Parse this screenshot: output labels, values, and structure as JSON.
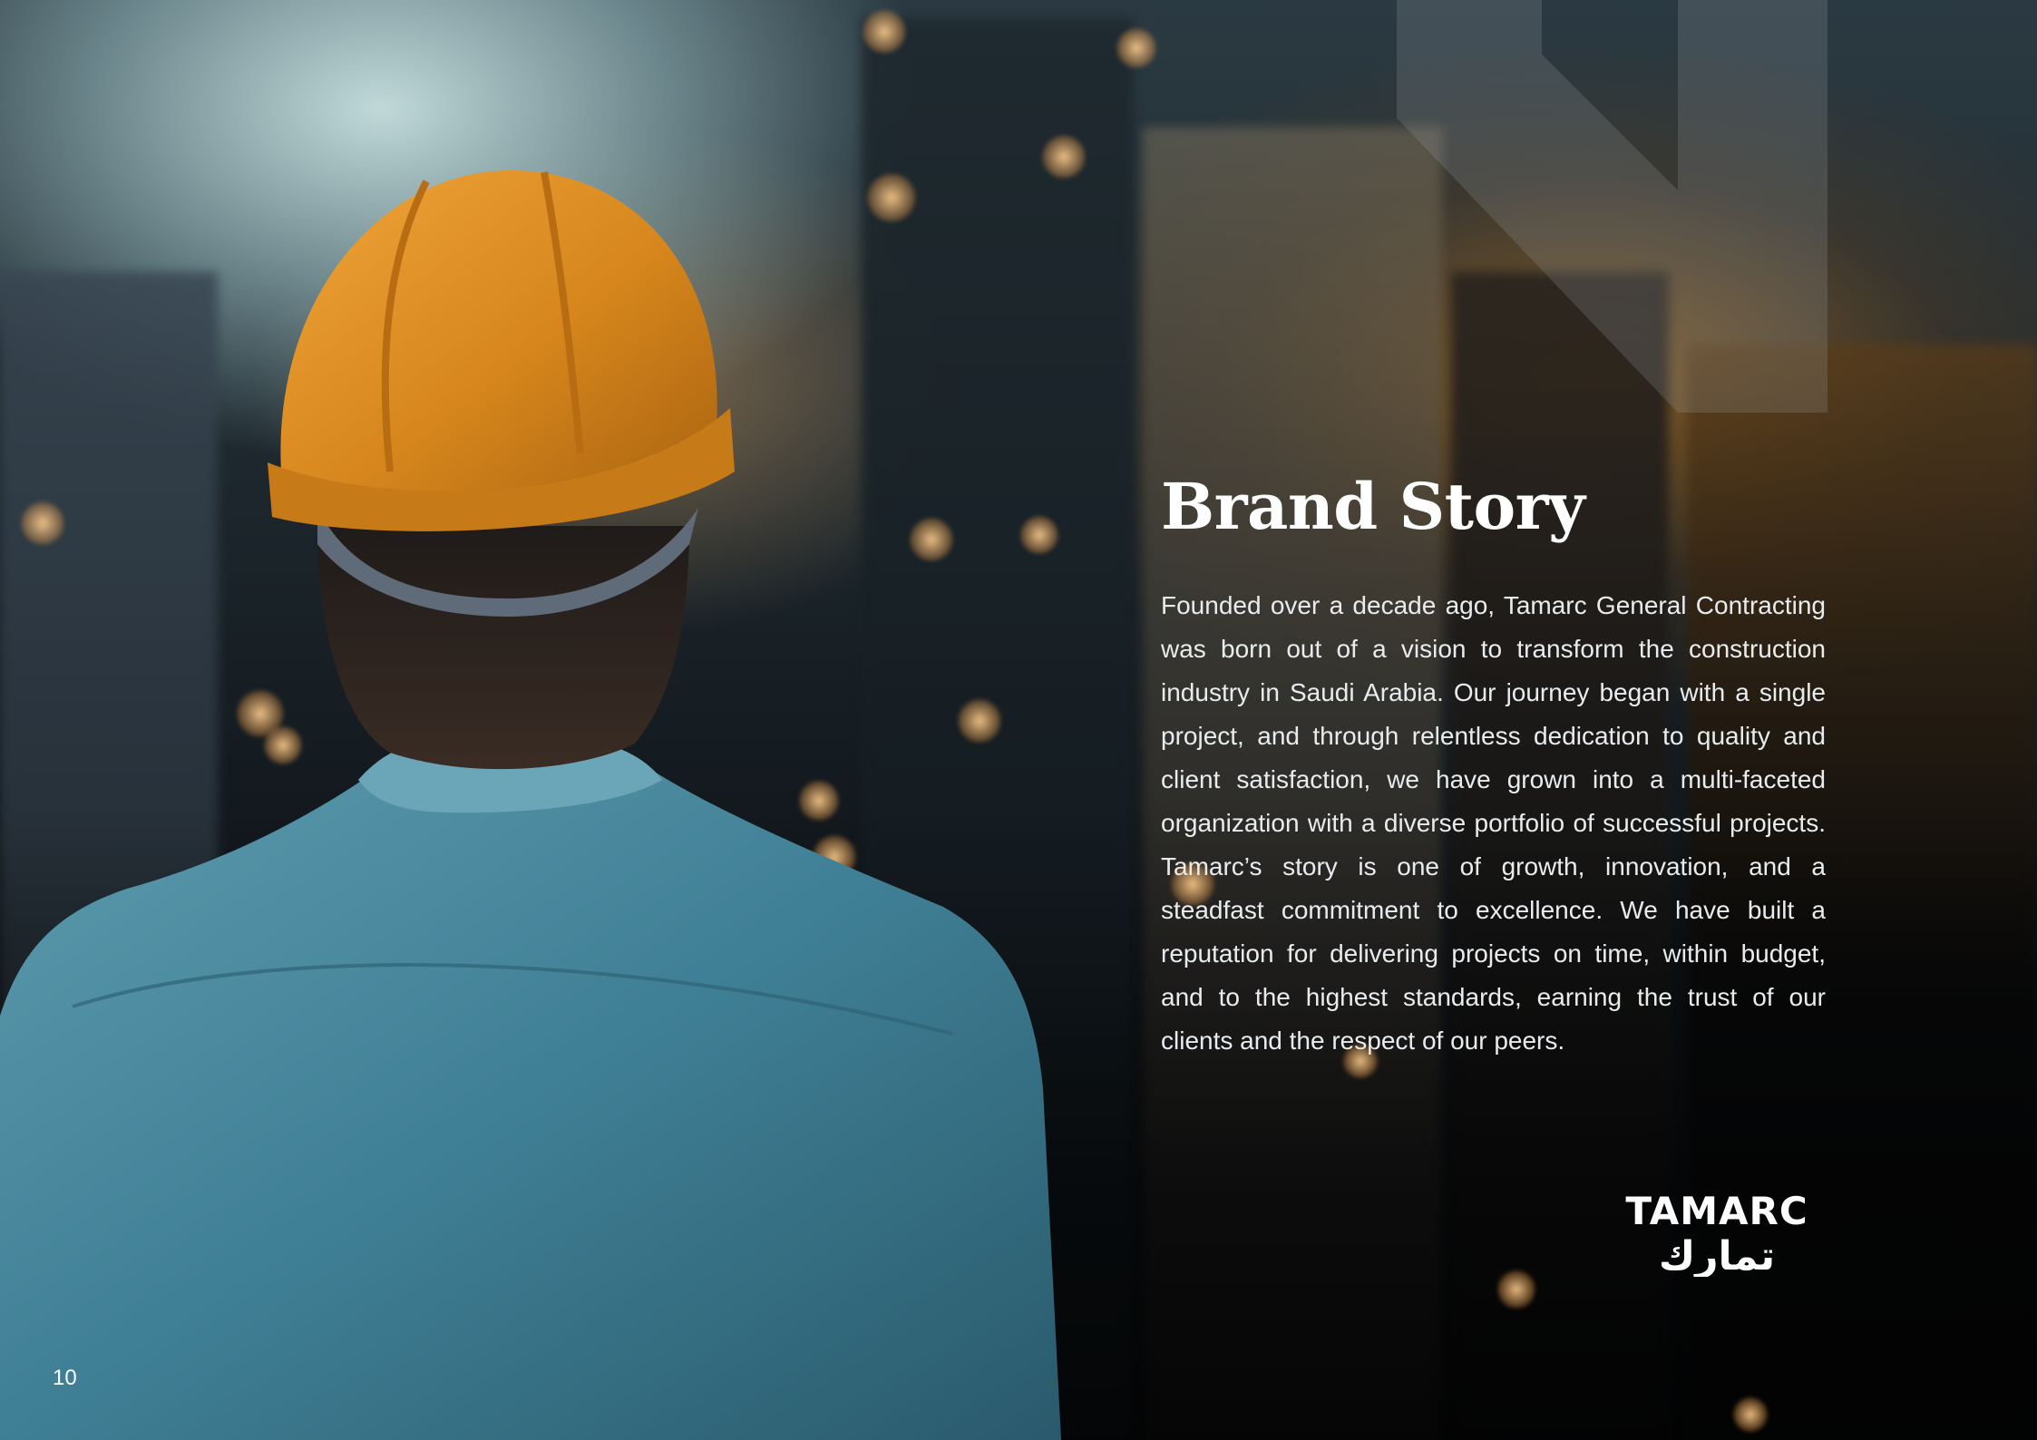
{
  "page": {
    "title": "Brand Story",
    "body": "Founded over a decade ago, Tamarc General Contracting was born out of a vision to transform the construction industry in Saudi Arabia. Our journey began with a single project, and through relentless dedication to quality and client satisfaction, we have grown into a multi-faceted organization with a diverse portfolio of successful projects. Tamarc’s story is one of growth, innovation, and a steadfast commitment to excellence. We have built a reputation for delivering projects on time, within budget, and to the highest standards, earning the trust of our clients and the respect of our peers.",
    "page_number": "10"
  },
  "logo": {
    "latin": "TAMARC",
    "arabic": "تمارك"
  },
  "colors": {
    "text": "#ffffff",
    "helmet": "#d98a1e",
    "shirt": "#3f7f95",
    "sky": "#c8dede"
  },
  "imagery": {
    "background": "construction-worker-photo",
    "decoration": "brand-shape"
  }
}
